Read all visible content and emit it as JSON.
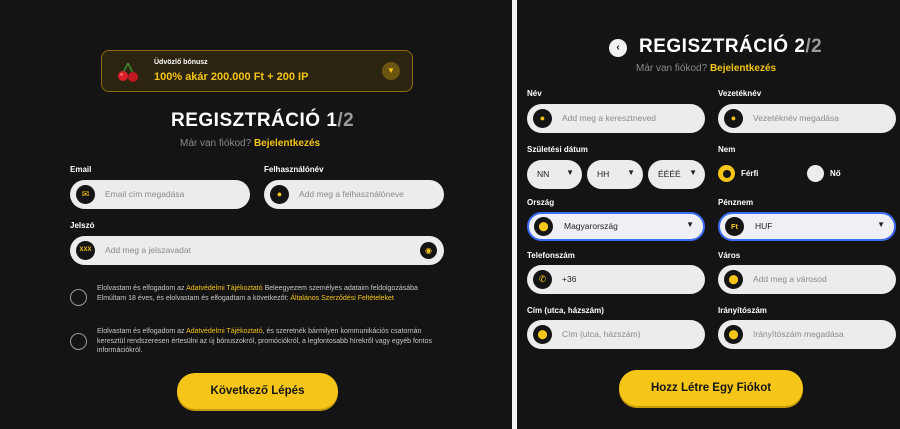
{
  "step1": {
    "bonus": {
      "small": "Üdvözlő bónusz",
      "big": "100% akár 200.000 Ft + 200 IP"
    },
    "title_main": "REGISZTRÁCIÓ 1",
    "title_suffix": "/2",
    "have_account": "Már van fiókod?",
    "login_link": "Bejelentkezés",
    "email": {
      "label": "Email",
      "placeholder": "Email cím megadása"
    },
    "username": {
      "label": "Felhasználónév",
      "placeholder": "Add meg a felhasználóneve"
    },
    "password": {
      "label": "Jelszó",
      "placeholder": "Add meg a jelszavadat",
      "icon_text": "XXX"
    },
    "consent1": {
      "part1": "Elolvastam és elfogadom az ",
      "link1": "Adatvédelmi Tájékoztató",
      "part2": " Beleegyezem személyes adataim feldolgozásába  Elmúltam 18 éves, és elolvastam és elfogadtam a következőt: ",
      "link2": "Általános Szerződési Feltételeket"
    },
    "consent2": {
      "part1": "Elolvastam és elfogadom az ",
      "link1": "Adatvédelmi Tájékoztató",
      "part2": ", és szeretnék bármilyen kommunikációs csatornán keresztül rendszeresen értesülni az új bónuszokról, promóciókról, a legfontosabb hírekről vagy egyéb fontos információkról."
    },
    "next_button": "Következő Lépés"
  },
  "step2": {
    "title_main": "REGISZTRÁCIÓ 2",
    "title_suffix": "/2",
    "have_account": "Már van fiókod?",
    "login_link": "Bejelentkezés",
    "name": {
      "label": "Név",
      "placeholder": "Add meg a keresztneved"
    },
    "surname": {
      "label": "Vezetéknév",
      "placeholder": "Vezetéknév megadása"
    },
    "dob": {
      "label": "Születési dátum",
      "day": "NN",
      "month": "HH",
      "year": "ÉÉÉÉ"
    },
    "gender": {
      "label": "Nem",
      "male": "Férfi",
      "female": "Nő",
      "selected": "male"
    },
    "country": {
      "label": "Ország",
      "value": "Magyarország"
    },
    "currency": {
      "label": "Pénznem",
      "value": "HUF",
      "icon_text": "Ft"
    },
    "phone": {
      "label": "Telefonszám",
      "value": "+36"
    },
    "city": {
      "label": "Város",
      "placeholder": "Add meg a városod"
    },
    "address": {
      "label": "Cím (utca, házszám)",
      "placeholder": "Cím (utca, házszám)"
    },
    "zip": {
      "label": "Irányítószám",
      "placeholder": "Irányítószám megadása"
    },
    "create_button": "Hozz Létre Egy Fiókot"
  },
  "colors": {
    "bg": "#141414",
    "accent": "#f5c518",
    "field": "#ececec",
    "focus": "#3b6cf6"
  }
}
